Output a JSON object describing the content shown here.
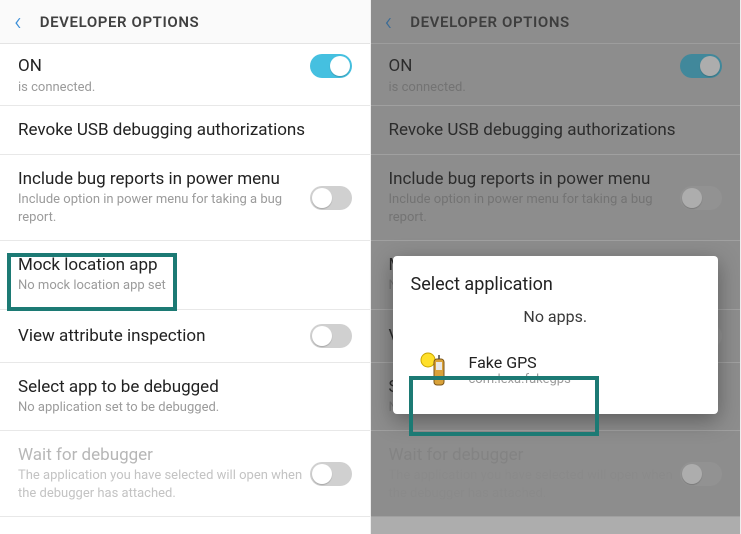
{
  "header": {
    "title": "DEVELOPER OPTIONS"
  },
  "dev": {
    "on_label": "ON",
    "is_connected": "is connected.",
    "revoke": "Revoke USB debugging authorizations",
    "bug_title": "Include bug reports in power menu",
    "bug_sub": "Include option in power menu for taking a bug report.",
    "mock_title": "Mock location app",
    "mock_sub": "No mock location app set",
    "view_attr": "View attribute inspection",
    "debug_app_title": "Select app to be debugged",
    "debug_app_sub": "No application set to be debugged.",
    "wait_title": "Wait for debugger",
    "wait_sub": "The application you have selected will open when the debugger has attached."
  },
  "dialog": {
    "title": "Select application",
    "no_apps": "No apps.",
    "app_name": "Fake GPS",
    "app_pkg": "com.lexa.fakegps"
  }
}
